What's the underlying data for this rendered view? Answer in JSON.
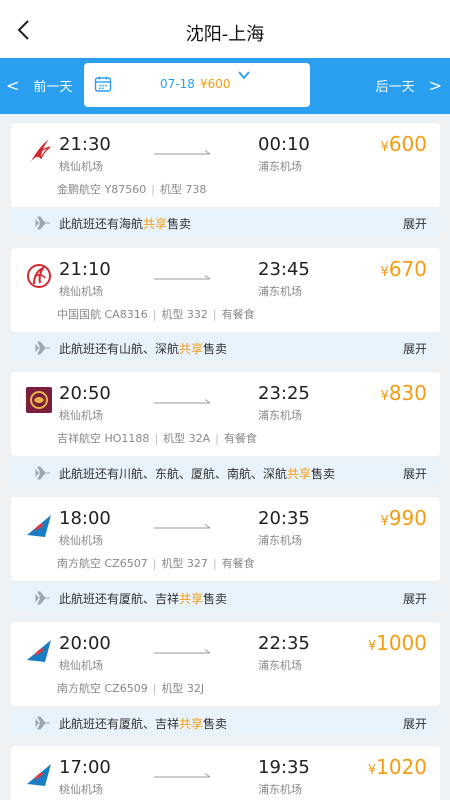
{
  "header": {
    "title": "沈阳-上海"
  },
  "datebar": {
    "prev_label": "前一天",
    "next_label": "后一天",
    "date": "07-18",
    "price": "¥600"
  },
  "flights": [
    {
      "airline": "金鹏航空",
      "flight_no": "Y87560",
      "aircraft": "机型 738",
      "meal": "",
      "dep_time": "21:30",
      "dep_airport": "桃仙机场",
      "arr_time": "00:10",
      "arr_airport": "浦东机场",
      "price_symbol": "¥",
      "price": "600",
      "share_prefix": "此航班还有海航",
      "share_hl": "共享",
      "share_suffix": "售卖",
      "expand": "展开"
    },
    {
      "airline": "中国国航",
      "flight_no": "CA8316",
      "aircraft": "机型 332",
      "meal": "有餐食",
      "dep_time": "21:10",
      "dep_airport": "桃仙机场",
      "arr_time": "23:45",
      "arr_airport": "浦东机场",
      "price_symbol": "¥",
      "price": "670",
      "share_prefix": "此航班还有山航、深航",
      "share_hl": "共享",
      "share_suffix": "售卖",
      "expand": "展开"
    },
    {
      "airline": "吉祥航空",
      "flight_no": "HO1188",
      "aircraft": "机型 32A",
      "meal": "有餐食",
      "dep_time": "20:50",
      "dep_airport": "桃仙机场",
      "arr_time": "23:25",
      "arr_airport": "浦东机场",
      "price_symbol": "¥",
      "price": "830",
      "share_prefix": "此航班还有川航、东航、厦航、南航、深航",
      "share_hl": "共享",
      "share_suffix": "售卖",
      "expand": "展开"
    },
    {
      "airline": "南方航空",
      "flight_no": "CZ6507",
      "aircraft": "机型 327",
      "meal": "有餐食",
      "dep_time": "18:00",
      "dep_airport": "桃仙机场",
      "arr_time": "20:35",
      "arr_airport": "浦东机场",
      "price_symbol": "¥",
      "price": "990",
      "share_prefix": "此航班还有厦航、吉祥",
      "share_hl": "共享",
      "share_suffix": "售卖",
      "expand": "展开"
    },
    {
      "airline": "南方航空",
      "flight_no": "CZ6509",
      "aircraft": "机型 32J",
      "meal": "",
      "dep_time": "20:00",
      "dep_airport": "桃仙机场",
      "arr_time": "22:35",
      "arr_airport": "浦东机场",
      "price_symbol": "¥",
      "price": "1000",
      "share_prefix": "此航班还有厦航、吉祥",
      "share_hl": "共享",
      "share_suffix": "售卖",
      "expand": "展开"
    },
    {
      "airline": "",
      "flight_no": "",
      "aircraft": "",
      "meal": "",
      "dep_time": "17:00",
      "dep_airport": "桃仙机场",
      "arr_time": "19:35",
      "arr_airport": "浦东机场",
      "price_symbol": "¥",
      "price": "1020",
      "share_prefix": "",
      "share_hl": "",
      "share_suffix": "",
      "expand": ""
    }
  ],
  "colors": {
    "accent": "#2a9ff0",
    "price": "#f39c12",
    "share_bg": "#e7f2fb"
  }
}
